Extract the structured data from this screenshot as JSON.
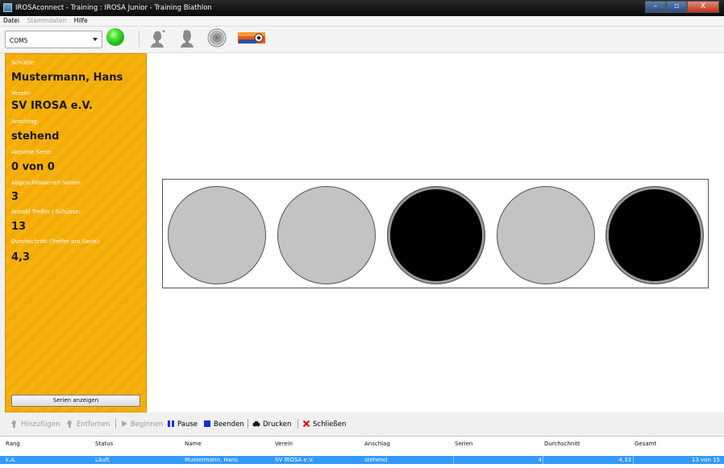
{
  "window": {
    "title": "IROSAconnect - Training : IROSA Junior - Training Biathlon",
    "controls": {
      "minimize": "–",
      "maximize": "▫",
      "close": "X"
    }
  },
  "menu": {
    "items": [
      {
        "label": "Datei",
        "enabled": true
      },
      {
        "label": "Stammdaten",
        "enabled": false
      },
      {
        "label": "Hilfe",
        "enabled": true
      }
    ]
  },
  "toolbar": {
    "port_select": "COM5",
    "connection_status": "connected",
    "status_color": "#2ecc1f",
    "tools": [
      "shooter-add-icon",
      "shooter-icon",
      "target-icon",
      "biathlon-target-icon"
    ]
  },
  "shooter_panel": {
    "shooter_label": "Schütze:",
    "shooter_value": "Mustermann, Hans",
    "club_label": "Verein:",
    "club_value": "SV IROSA e.V.",
    "position_label": "Anschlag:",
    "position_value": "stehend",
    "current_series_label": "Aktuelle Serie:",
    "current_series_value": "0 von 0",
    "completed_series_label": "Abgeschlossenen Serien:",
    "completed_series_value": "3",
    "hits_label": "Anzahl Treffer / Schüsse:",
    "hits_value": "13",
    "average_label": "Durchschnitt (Treffer pro Serie):",
    "average_value": "4,3",
    "show_series_button": "Serien anzeigen",
    "panel_color": "#f5ae08"
  },
  "targets": [
    {
      "state": "miss"
    },
    {
      "state": "miss"
    },
    {
      "state": "hit"
    },
    {
      "state": "miss"
    },
    {
      "state": "hit"
    }
  ],
  "actions": {
    "add": "Hinzufügen",
    "remove": "Entfernen",
    "start": "Beginnen",
    "pause": "Pause",
    "stop": "Beenden",
    "print": "Drucken",
    "close": "Schließen"
  },
  "table": {
    "columns": [
      "Rang",
      "Status",
      "Name",
      "Verein",
      "Anschlag",
      "Serien",
      "Durchschnitt",
      "Gesamt"
    ],
    "rows": [
      {
        "rang": "k.A.",
        "status": "Läuft",
        "name": "Mustermann, Hans",
        "verein": "SV IROSA e.V.",
        "anschlag": "stehend",
        "serien": "4",
        "durchschnitt": "4,33",
        "gesamt": "13 von 15"
      }
    ],
    "selection_color": "#3399ff"
  }
}
